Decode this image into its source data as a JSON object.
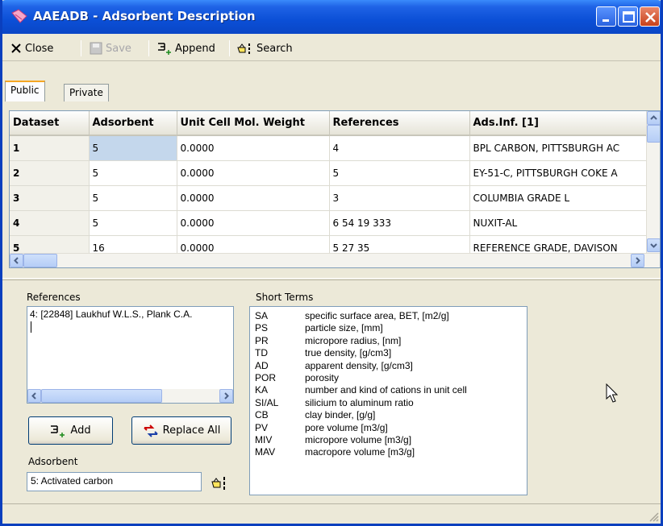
{
  "window": {
    "title": "AAEADB - Adsorbent Description",
    "controls": [
      "minimize",
      "maximize",
      "close"
    ]
  },
  "toolbar": {
    "close_label": "Close",
    "save_label": "Save",
    "append_label": "Append",
    "search_label": "Search"
  },
  "tabs": [
    {
      "label": "Public",
      "active": true
    },
    {
      "label": "Private",
      "active": false
    }
  ],
  "grid": {
    "columns": [
      "Dataset",
      "Adsorbent",
      "Unit Cell Mol. Weight",
      "References",
      "Ads.Inf. [1]"
    ],
    "rows": [
      [
        "1",
        "5",
        "0.0000",
        "4",
        "BPL CARBON, PITTSBURGH AC"
      ],
      [
        "2",
        "5",
        "0.0000",
        "5",
        "EY-51-C, PITTSBURGH COKE A"
      ],
      [
        "3",
        "5",
        "0.0000",
        "3",
        "COLUMBIA GRADE L"
      ],
      [
        "4",
        "5",
        "0.0000",
        "6 54 19 333",
        "NUXIT-AL"
      ],
      [
        "5",
        "16",
        "0.0000",
        "5 27 35",
        "REFERENCE GRADE, DAVISON"
      ]
    ]
  },
  "references": {
    "label": "References",
    "text": "4: [22848] Laukhuf W.L.S., Plank C.A."
  },
  "buttons": {
    "add_label": "Add",
    "replace_all_label": "Replace All"
  },
  "adsorbent": {
    "label": "Adsorbent",
    "value": "5: Activated carbon"
  },
  "short_terms": {
    "label": "Short Terms",
    "items": [
      {
        "abbr": "SA",
        "desc": "specific surface area, BET, [m2/g]"
      },
      {
        "abbr": "PS",
        "desc": "particle size, [mm]"
      },
      {
        "abbr": "PR",
        "desc": "micropore radius, [nm]"
      },
      {
        "abbr": "TD",
        "desc": "true density, [g/cm3]"
      },
      {
        "abbr": "AD",
        "desc": "apparent density, [g/cm3]"
      },
      {
        "abbr": "POR",
        "desc": "porosity"
      },
      {
        "abbr": "KA",
        "desc": "number and kind of cations in unit cell"
      },
      {
        "abbr": "SI/AL",
        "desc": "silicium to aluminum ratio"
      },
      {
        "abbr": "CB",
        "desc": "clay binder, [g/g]"
      },
      {
        "abbr": "PV",
        "desc": "pore volume [m3/g]"
      },
      {
        "abbr": "MIV",
        "desc": "micropore volume [m3/g]"
      },
      {
        "abbr": "MAV",
        "desc": "macropore volume [m3/g]"
      }
    ]
  },
  "colors": {
    "titlebar": "#0b4fd6",
    "selected_cell": "#c4d7ec",
    "window_bg": "#ece9d8"
  }
}
